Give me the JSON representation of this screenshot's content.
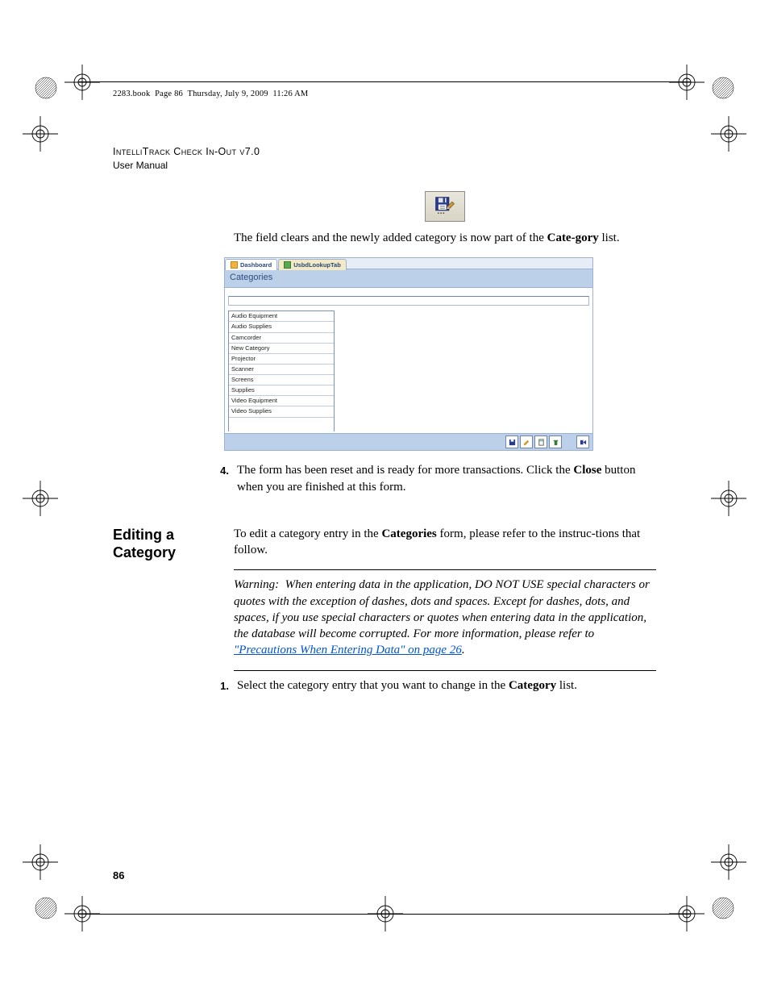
{
  "runningHead": "2283.book  Page 86  Thursday, July 9, 2009  11:26 AM",
  "productLine": "IntelliTrack Check In-Out v7.0",
  "subtitle": "User Manual",
  "para1_a": "The field clears and the newly added category is now part of the ",
  "para1_bold": "Cate-gory",
  "para1_b": " list.",
  "screenshot": {
    "tabs": [
      "Dashboard",
      "UsbdLookupTab"
    ],
    "title": "Categories",
    "categories": [
      "Audio Equipment",
      "Audio Supplies",
      "Camcorder",
      "New Category",
      "Projector",
      "Scanner",
      "Screens",
      "Supplies",
      "Video Equipment",
      "Video Supplies"
    ]
  },
  "step4_num": "4.",
  "step4_a": "The form has been reset and is ready for more transactions. Click the ",
  "step4_bold": "Close",
  "step4_b": " button when you are finished at this form.",
  "sideHeading": "Editing a Category",
  "editIntro_a": "To edit a category entry in the ",
  "editIntro_bold": "Categories",
  "editIntro_b": " form, please refer to the instruc-tions that follow.",
  "warning_label": "Warning:",
  "warning_body": "When entering data in the application, DO NOT USE special characters or quotes with the exception of dashes, dots and spaces. Except for dashes, dots, and spaces, if you use special characters or quotes when entering data in the application, the database will become corrupted. For more information, please refer to ",
  "warning_link": "\"Precautions When Entering Data\" on page 26",
  "warning_tail": ".",
  "step1_num": "1.",
  "step1_a": "Select the category entry that you want to change in the ",
  "step1_bold": "Category",
  "step1_b": " list.",
  "pageNumber": "86"
}
